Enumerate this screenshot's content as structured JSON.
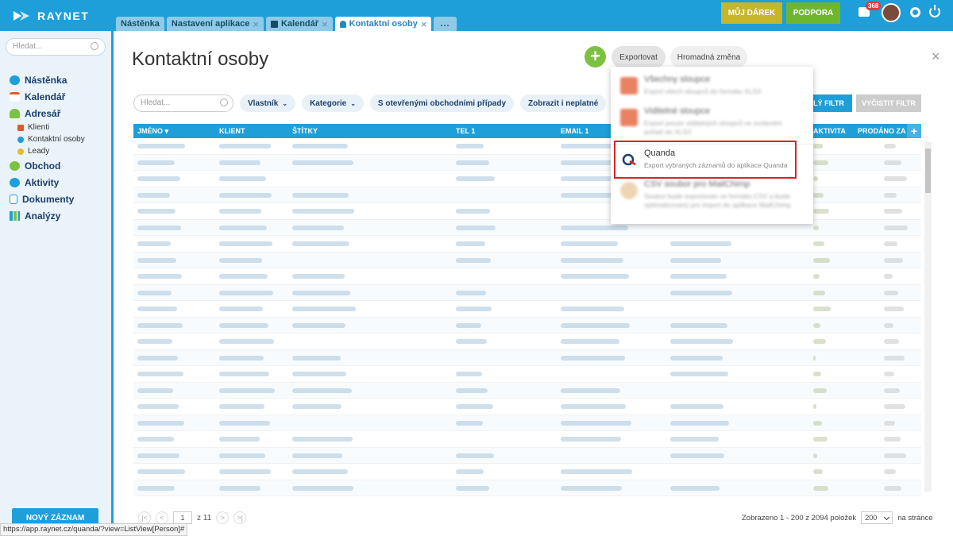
{
  "app": {
    "logo": "RAYNET"
  },
  "tabs": [
    {
      "label": "Nástěnka",
      "closable": false,
      "active": false
    },
    {
      "label": "Nastavení aplikace",
      "closable": true,
      "active": false
    },
    {
      "label": "Kalendář",
      "closable": true,
      "active": false
    },
    {
      "label": "Kontaktní osoby",
      "closable": true,
      "active": true
    }
  ],
  "tabs_more": "...",
  "header": {
    "gift": "MŮJ DÁREK",
    "support": "PODPORA",
    "notifications": "368"
  },
  "sidebar": {
    "search_placeholder": "Hledat...",
    "items": [
      {
        "label": "Nástěnka",
        "color": "#1e9fd9"
      },
      {
        "label": "Kalendář",
        "color": "#e4572e"
      },
      {
        "label": "Adresář",
        "color": "#7cc242"
      },
      {
        "label": "Obchod",
        "color": "#7cc242"
      },
      {
        "label": "Aktivity",
        "color": "#1e9fd9"
      },
      {
        "label": "Dokumenty",
        "color": "#1e9fd9"
      },
      {
        "label": "Analýzy",
        "color": "#7cc242"
      }
    ],
    "subitems": [
      {
        "label": "Klienti",
        "color": "#e4572e"
      },
      {
        "label": "Kontaktní osoby",
        "color": "#1e9fd9"
      },
      {
        "label": "Leady",
        "color": "#e8b935"
      }
    ],
    "new_record": "NOVÝ ZÁZNAM"
  },
  "main": {
    "title": "Kontaktní osoby",
    "add": "+",
    "export": "Exportovat",
    "bulk_change": "Hromadná změna",
    "close": "×"
  },
  "filters": {
    "search_placeholder": "Hledat...",
    "owner": "Vlastník",
    "category": "Kategorie",
    "open_deals": "S otevřenými obchodními případy",
    "show_invalid": "Zobrazit i neplatné",
    "apply": "LÝ FILTR",
    "clear": "VYČISTIT FILTR"
  },
  "table": {
    "columns": [
      "JMÉNO",
      "KLIENT",
      "ŠTÍTKY",
      "TEL 1",
      "EMAIL 1",
      "AKTIVITA",
      "PRODÁNO ZA"
    ],
    "add_column": "+"
  },
  "export_menu": {
    "items": [
      {
        "title": "Všechny sloupce",
        "desc": "Export všech sloupců do formátu XLSX"
      },
      {
        "title": "Viditelné sloupce",
        "desc": "Export pouze viditelných sloupců ve zvoleném pořadí do XLSX"
      },
      {
        "title": "Quanda",
        "desc": "Export vybraných záznamů do aplikace Quanda"
      },
      {
        "title": "CSV soubor pro MailChimp",
        "desc": "Soubor bude exportován ve formátu CSV a bude optimalizovaný pro import do aplikace MailChimp"
      }
    ]
  },
  "pager": {
    "first": "|<",
    "prev": "<",
    "page": "1",
    "of": "z 11",
    "next": ">",
    "last": ">|",
    "summary": "Zobrazeno 1 - 200 z 2094 položek",
    "per_page": "200",
    "per_page_suffix": "na stránce"
  },
  "status_url": "https://app.raynet.cz/quanda/?view=ListView[Person]#"
}
